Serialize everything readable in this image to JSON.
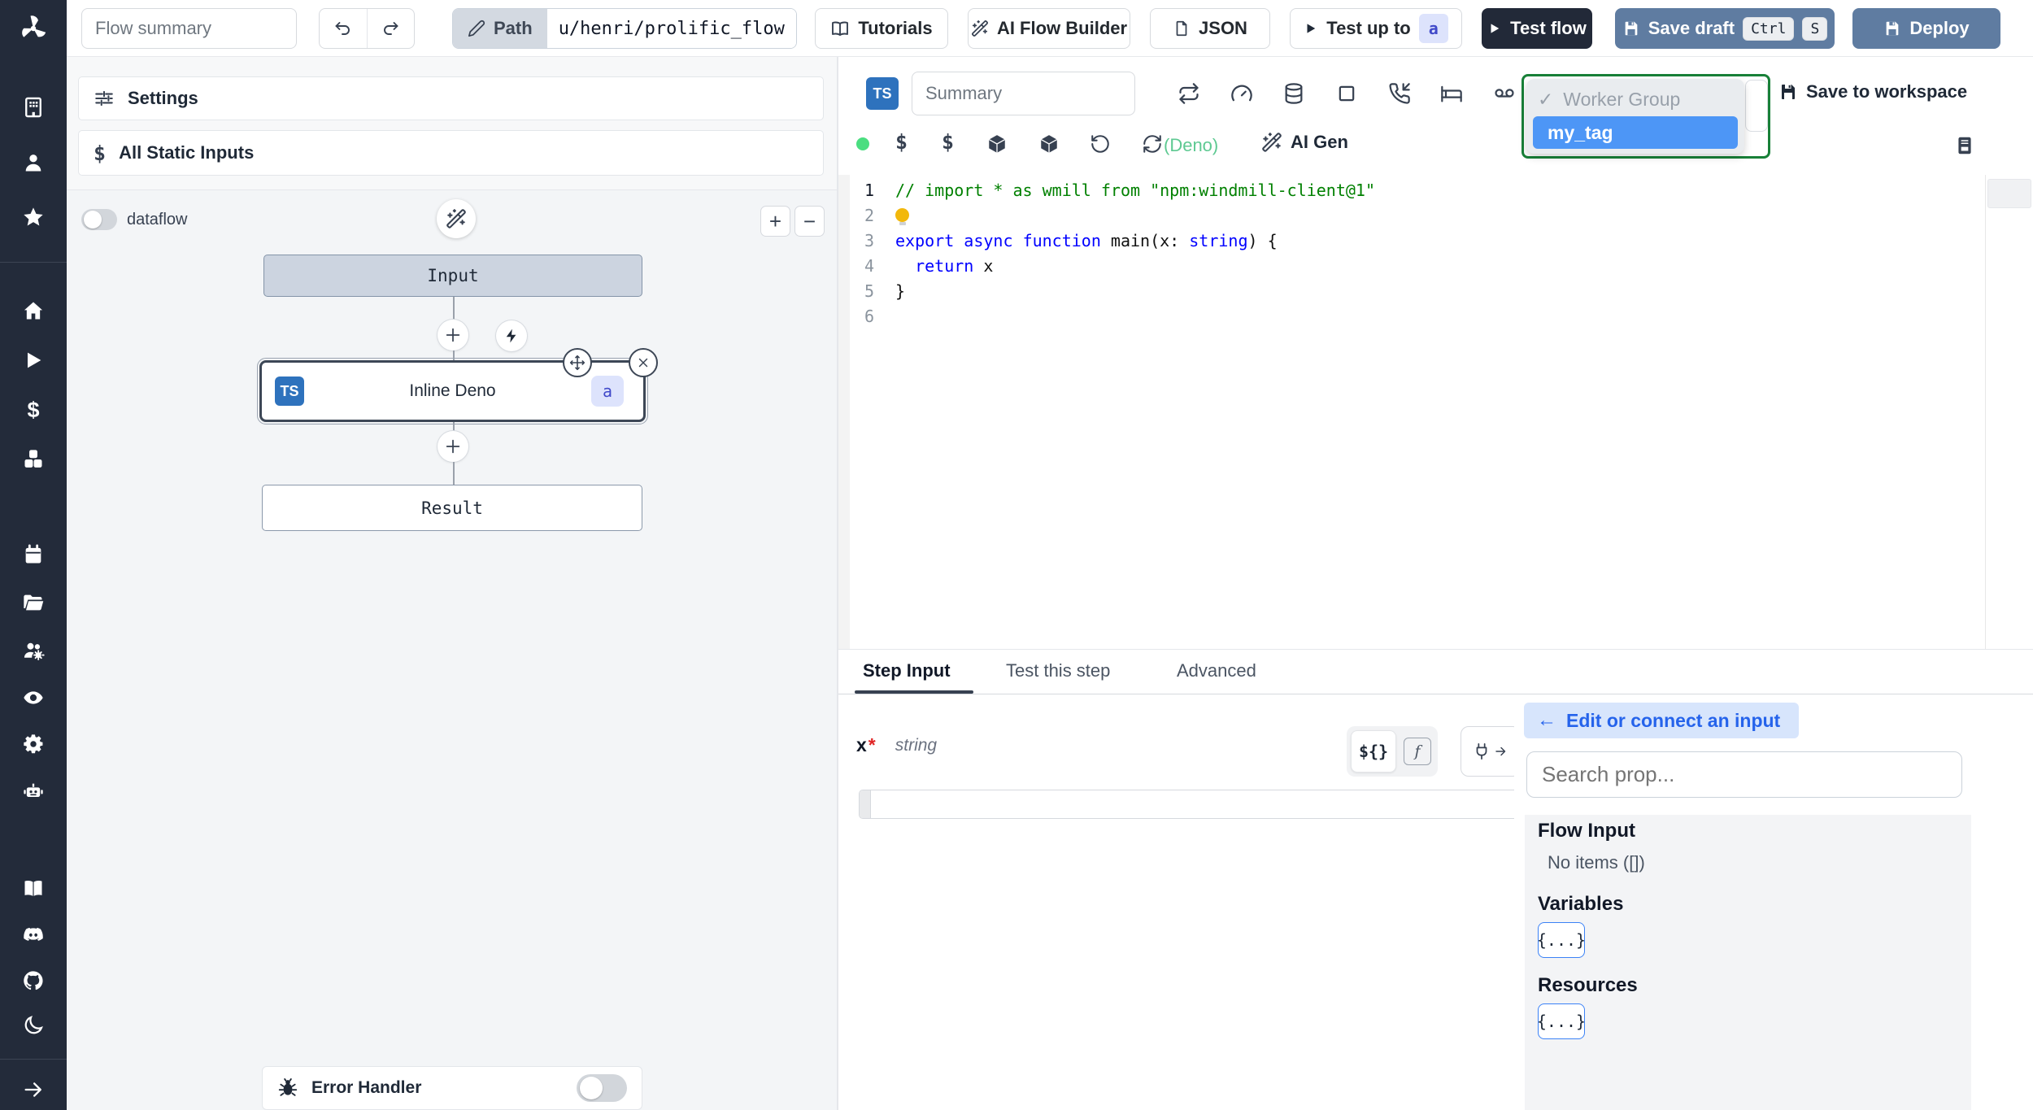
{
  "colors": {
    "sidebar_dark": "#232b3a",
    "steel_blue_button": "#5f7ca1",
    "select_green_border": "#188038",
    "option_highlight_blue": "#4d96f6",
    "deno_green": "#5ec992",
    "status_dot_green": "#4ade80",
    "badge_indigo_bg": "#dde3fc",
    "badge_indigo_text": "#4049c9"
  },
  "icons": {
    "sidebar": [
      "windmill-logo",
      "workspace-building-icon",
      "user-icon",
      "favorites-star-icon",
      "home-icon",
      "runs-play-icon",
      "variables-dollar-icon",
      "resources-boxes-icon",
      "schedules-calendar-icon",
      "folders-icon",
      "groups-users-gear-icon",
      "audit-eye-icon",
      "workers-gear-icon",
      "ai-robot-icon",
      "docs-book-icon",
      "discord-icon",
      "github-icon",
      "dark-mode-moon-icon",
      "expand-arrow-icon"
    ],
    "editor_toolbar": [
      "retry-repeat-icon",
      "concurrency-gauge-icon",
      "cache-database-icon",
      "early-stop-square-icon",
      "suspend-phone-icon",
      "sleep-bed-icon",
      "mock-voicemail-icon"
    ],
    "plus": "+",
    "minus": "−",
    "check": "✓",
    "arrow_left": "←",
    "arrow_right": "→"
  },
  "topbar": {
    "flow_summary_placeholder": "Flow summary",
    "path_label": "Path",
    "path_value": "u/henri/prolific_flow",
    "tutorials_label": "Tutorials",
    "ai_flow_builder_label": "AI Flow Builder",
    "json_label": "JSON",
    "test_up_to_label": "Test up to",
    "test_up_to_badge": "a",
    "test_flow_label": "Test flow",
    "save_draft_label": "Save draft",
    "kbd_ctrl": "Ctrl",
    "kbd_s": "S",
    "deploy_label": "Deploy"
  },
  "left_panel": {
    "settings_label": "Settings",
    "static_inputs_icon": "$",
    "all_static_inputs_label": "All Static Inputs",
    "dataflow_label": "dataflow",
    "zoom_in_label": "+",
    "zoom_out_label": "−",
    "graph": {
      "input_label": "Input",
      "step_lang_badge": "TS",
      "step_label": "Inline Deno",
      "step_id_badge": "a",
      "result_label": "Result",
      "error_handler_label": "Error Handler"
    }
  },
  "editor": {
    "lang_badge": "TS",
    "summary_placeholder": "Summary",
    "tag_select": {
      "check": "✓",
      "placeholder_option": "Worker Group",
      "highlighted_option": "my_tag"
    },
    "save_to_workspace_label": "Save to workspace",
    "dollar_icon": "$",
    "deno_label": "(Deno)",
    "ai_gen_label": "AI Gen",
    "code": {
      "lines": [
        {
          "num": 1,
          "tokens": [
            [
              "cmt",
              "// import * as wmill from \"npm:windmill-client@1\""
            ]
          ]
        },
        {
          "num": 2,
          "lightbulb": true,
          "tokens": []
        },
        {
          "num": 3,
          "tokens": [
            [
              "kw",
              "export"
            ],
            [
              "pl",
              " "
            ],
            [
              "kw",
              "async"
            ],
            [
              "pl",
              " "
            ],
            [
              "kw",
              "function"
            ],
            [
              "pl",
              " main(x: "
            ],
            [
              "kw",
              "string"
            ],
            [
              "pl",
              ") {"
            ]
          ]
        },
        {
          "num": 4,
          "tokens": [
            [
              "pl",
              "  "
            ],
            [
              "kw",
              "return"
            ],
            [
              "pl",
              " x"
            ]
          ]
        },
        {
          "num": 5,
          "tokens": [
            [
              "pl",
              "}"
            ]
          ]
        },
        {
          "num": 6,
          "tokens": []
        }
      ]
    }
  },
  "step_panel": {
    "tabs": [
      {
        "label": "Step Input"
      },
      {
        "label": "Test this step"
      },
      {
        "label": "Advanced"
      }
    ],
    "field_name": "x",
    "field_required": "*",
    "field_type": "string",
    "expr_toggle_label": "${}",
    "fn_toggle_label": "f",
    "input_value": ""
  },
  "connect_panel": {
    "back_arrow": "←",
    "edit_button_label": "Edit or connect an input",
    "search_placeholder": "Search prop...",
    "flow_input_title": "Flow Input",
    "flow_input_empty": "No items ([])",
    "variables_title": "Variables",
    "variables_badge": "{...}",
    "resources_title": "Resources",
    "resources_badge": "{...}"
  }
}
